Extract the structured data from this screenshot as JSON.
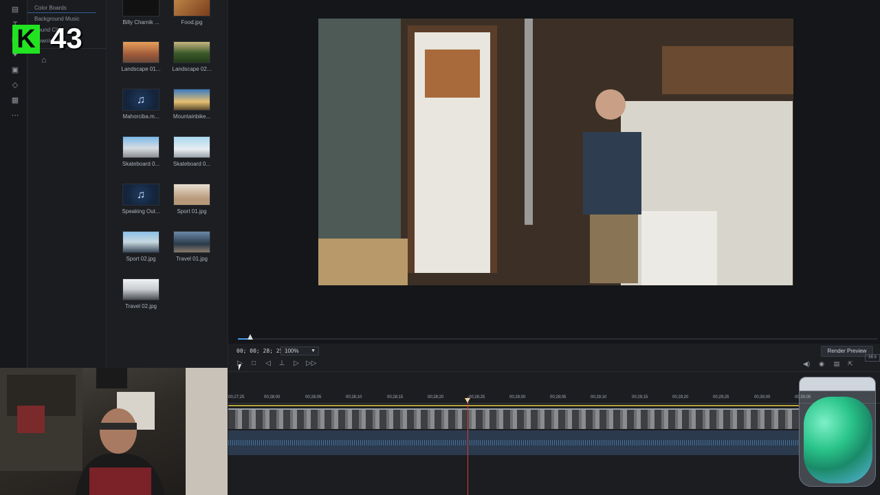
{
  "overlay": {
    "badge_letter": "K",
    "badge_number": "43"
  },
  "categories": [
    "Color Boards",
    "Background Music",
    "Sound Clips",
    "Downloads"
  ],
  "media": [
    {
      "label": "Billy Charnik ...",
      "kind": "image"
    },
    {
      "label": "Food.jpg",
      "kind": "image"
    },
    {
      "label": "Landscape 01...",
      "kind": "image"
    },
    {
      "label": "Landscape 02...",
      "kind": "image"
    },
    {
      "label": "Mahorciba.m...",
      "kind": "music"
    },
    {
      "label": "Mountainbike...",
      "kind": "video"
    },
    {
      "label": "Skateboard 0...",
      "kind": "video"
    },
    {
      "label": "Skateboard 0...",
      "kind": "video"
    },
    {
      "label": "Speaking Out...",
      "kind": "music"
    },
    {
      "label": "Sport 01.jpg",
      "kind": "image"
    },
    {
      "label": "Sport 02.jpg",
      "kind": "image"
    },
    {
      "label": "Travel 01.jpg",
      "kind": "image"
    },
    {
      "label": "Travel 02.jpg",
      "kind": "image"
    }
  ],
  "preview": {
    "timecode": "00; 00; 28; 25",
    "zoom": "100%",
    "render_label": "Render Preview",
    "aspect": "16:9"
  },
  "timeline": {
    "ticks": [
      "00;27;25",
      "00;28;00",
      "00;28;05",
      "00;28;10",
      "00;28;15",
      "00;28;20",
      "00;28;25",
      "00;29;00",
      "00;29;05",
      "00;29;10",
      "00;29;15",
      "00;29;20",
      "00;29;25",
      "00;30;00",
      "00;30;05"
    ]
  },
  "icons": {
    "play": "play-icon",
    "stop": "stop-icon",
    "prev": "previous-frame-icon",
    "split": "split-icon",
    "next": "next-frame-icon",
    "fast_forward": "fast-forward-icon",
    "volume": "volume-icon",
    "snapshot": "snapshot-icon",
    "subtitles": "subtitles-icon",
    "undock": "undock-icon"
  }
}
